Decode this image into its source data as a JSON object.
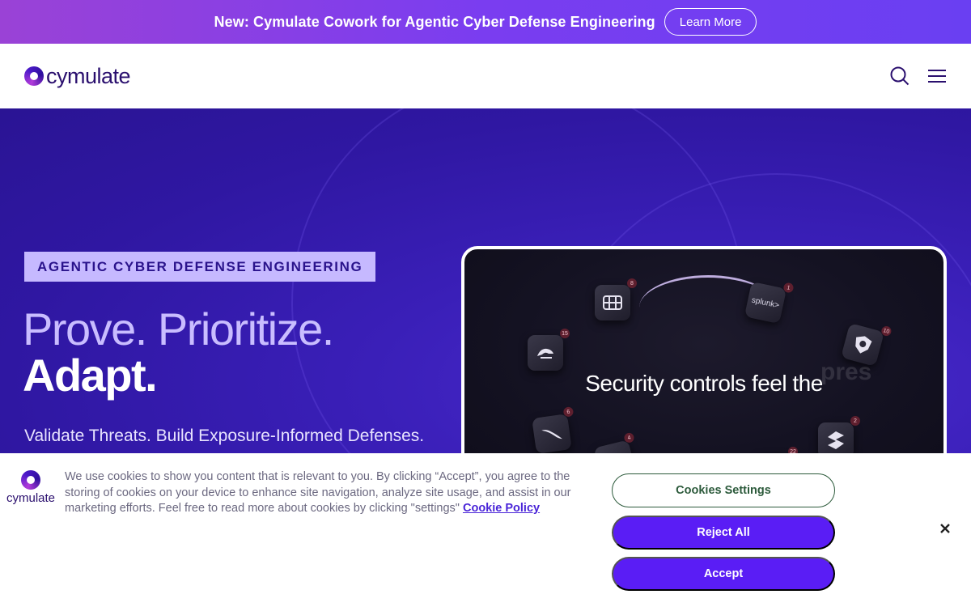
{
  "announcement": {
    "text": "New: Cymulate Cowork for Agentic Cyber Defense Engineering",
    "button_label": "Learn More"
  },
  "header": {
    "logo_text": "cymulate",
    "icons": [
      "search-icon",
      "hamburger-menu-icon"
    ]
  },
  "hero": {
    "tag": "AGENTIC CYBER DEFENSE ENGINEERING",
    "title_line1": "Prove. Prioritize.",
    "title_line2": "Adapt.",
    "subtitle": "Validate Threats. Build Exposure-Informed Defenses.",
    "video": {
      "caption": "Security controls feel the",
      "ghost_text": "pres",
      "tiles": [
        {
          "icon": "firewall-icon",
          "badge": "8"
        },
        {
          "icon": "splunk-icon",
          "label": "splunk>",
          "badge": "1"
        },
        {
          "icon": "zscaler-icon",
          "badge": "15"
        },
        {
          "icon": "shield-eye-icon",
          "badge": "10"
        },
        {
          "icon": "crowdstrike-falcon-icon",
          "badge": "6"
        },
        {
          "icon": "vendor-icon",
          "badge": "4"
        },
        {
          "icon": "s-logo-icon",
          "badge": "2"
        },
        {
          "icon": "vendor-icon",
          "badge": "22"
        }
      ]
    }
  },
  "cookie_banner": {
    "logo_text": "cymulate",
    "text": "We use cookies to show you content that is relevant to you. By clicking “Accept”, you agree to the storing of cookies on your device to enhance site navigation, analyze site usage, and assist in our marketing efforts. Feel free to read more about cookies by clicking \"settings\"",
    "link_label": "Cookie Policy",
    "settings_label": "Cookies Settings",
    "reject_label": "Reject All",
    "accept_label": "Accept",
    "close_icon": "close-icon"
  },
  "colors": {
    "accent": "#5a1df5",
    "hero_bg": "#2f17a2",
    "tag_bg": "#c6b9ff"
  }
}
